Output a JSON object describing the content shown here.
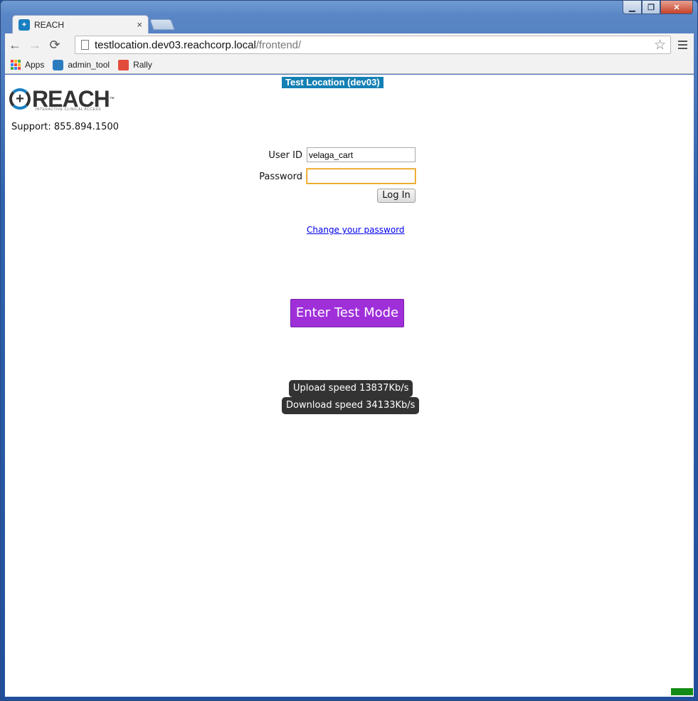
{
  "browser": {
    "tab_title": "REACH",
    "tab_close": "×",
    "url_host": "testlocation.dev03.reachcorp.local",
    "url_path": "/frontend/",
    "back_glyph": "←",
    "forward_glyph": "→",
    "reload_glyph": "⟳",
    "star_glyph": "☆",
    "window_buttons": {
      "minimize": "▁",
      "maximize": "❐",
      "close": "✕"
    }
  },
  "bookmarks": [
    {
      "label": "Apps",
      "icon": "apps-grid-icon"
    },
    {
      "label": "admin_tool",
      "icon": "admin-tool-icon"
    },
    {
      "label": "Rally",
      "icon": "rally-icon"
    }
  ],
  "page": {
    "env_banner": "Test Location (dev03)",
    "logo": {
      "text": "REACH",
      "tm": "™",
      "subtitle": "INTERACTIVE CLINICAL ACCESS"
    },
    "support": "Support: 855.894.1500",
    "login": {
      "user_id_label": "User ID",
      "user_id_value": "velaga_cart",
      "password_label": "Password",
      "password_value": "",
      "login_button": "Log In",
      "change_password_link": "Change your password"
    },
    "test_mode_button": "Enter Test Mode",
    "upload_speed": "Upload speed 13837Kb/s",
    "download_speed": "Download speed 34133Kb/s"
  },
  "colors": {
    "banner": "#1580b4",
    "test_mode": "#9f2fd9",
    "status_indicator": "#138a13",
    "link": "#0000ee"
  }
}
